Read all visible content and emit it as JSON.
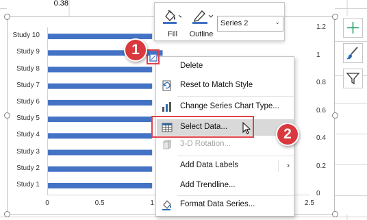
{
  "sheet": {
    "cell_value": "0.38"
  },
  "chart_data": {
    "type": "bar",
    "categories": [
      "Study 1",
      "Study 2",
      "Study 3",
      "Study 4",
      "Study 5",
      "Study 6",
      "Study 7",
      "Study 8",
      "Study 9",
      "Study 10"
    ],
    "series": [
      {
        "values": [
          1.0,
          1.0,
          1.0,
          1.0,
          1.0,
          1.0,
          1.0,
          1.0,
          1.1,
          1.0
        ],
        "color": "#4472c4"
      }
    ],
    "x_ticks": [
      "0",
      "0.5",
      "1",
      "1.5",
      "2",
      "2.5"
    ],
    "x_visible_ticks": [
      "0",
      "0.5",
      "1",
      "2.5"
    ],
    "xlim": [
      0,
      2.5
    ],
    "y2_ticks": [
      "1.2",
      "1",
      "0.8",
      "0.6",
      "0.4",
      "0.2",
      "0"
    ],
    "y2_visible_ticks": [
      "1.2",
      "1",
      "0.8",
      "0.6",
      "0.4",
      "0.2",
      "0"
    ],
    "grid": false
  },
  "minitoolbar": {
    "fill_label": "Fill",
    "outline_label": "Outline",
    "series_selected": "Series 2",
    "fill_icon": "paint-bucket-icon",
    "outline_icon": "pen-icon",
    "dropdown_icon": "chevron-down-icon"
  },
  "side_buttons": [
    {
      "icon": "plus-icon"
    },
    {
      "icon": "brush-icon"
    },
    {
      "icon": "filter-icon"
    }
  ],
  "context_menu": {
    "items": [
      {
        "label": "Delete",
        "icon": ""
      },
      {
        "label": "Reset to Match Style",
        "icon": "reset-icon"
      },
      {
        "label": "Change Series Chart Type...",
        "icon": "chart-icon"
      },
      {
        "label": "Select Data...",
        "icon": "table-icon"
      },
      {
        "label": "3-D Rotation...",
        "icon": "cube-icon"
      },
      {
        "label": "Add Data Labels",
        "icon": ""
      },
      {
        "label": "Add Trendline...",
        "icon": ""
      },
      {
        "label": "Format Data Series...",
        "icon": "paint-bucket-icon"
      }
    ]
  },
  "callouts": {
    "step1": "1",
    "step2": "2"
  },
  "colors": {
    "accent": "#4472c4",
    "callout": "#d9393e",
    "side_icon_green": "#21a366",
    "side_icon_blue": "#2b6cb0"
  }
}
